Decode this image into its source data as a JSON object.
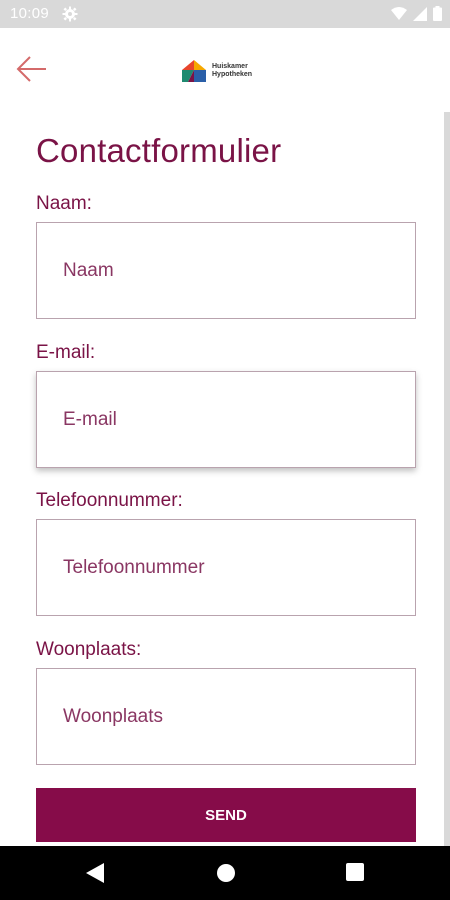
{
  "status_bar": {
    "time": "10:09",
    "icons": [
      "gear-icon",
      "wifi-icon",
      "signal-icon",
      "battery-icon"
    ]
  },
  "header": {
    "back_icon": "arrow-left-icon",
    "logo_line1": "Huiskamer",
    "logo_line2": "Hypotheken"
  },
  "form": {
    "title": "Contactformulier",
    "fields": [
      {
        "label": "Naam:",
        "placeholder": "Naam",
        "value": ""
      },
      {
        "label": "E-mail:",
        "placeholder": "E-mail",
        "value": ""
      },
      {
        "label": "Telefoonnummer:",
        "placeholder": "Telefoonnummer",
        "value": ""
      },
      {
        "label": "Woonplaats:",
        "placeholder": "Woonplaats",
        "value": ""
      }
    ],
    "submit_label": "SEND"
  },
  "nav_bar": {
    "icons": [
      "nav-back-icon",
      "nav-home-icon",
      "nav-recents-icon"
    ]
  },
  "colors": {
    "accent": "#7a1346",
    "button": "#860c49",
    "back_arrow": "#d46a6a",
    "status_bar": "#d9d9d9"
  }
}
